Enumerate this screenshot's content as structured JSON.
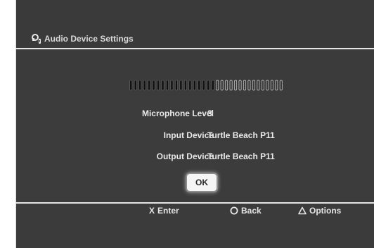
{
  "dialog": {
    "title": "Audio Device Settings",
    "title_icon": "headset-icon"
  },
  "meter": {
    "level_fraction": 0.55,
    "total_segments": 34,
    "filled_color": "#111111",
    "empty_color": "#cfcfcf"
  },
  "settings": {
    "mic_label": "Microphone Level",
    "mic_value": "3",
    "input_label": "Input Device",
    "input_value": "Turtle Beach P11",
    "output_label": "Output Device",
    "output_value": "Turtle Beach P11"
  },
  "buttons": {
    "ok_label": "OK"
  },
  "footer": {
    "enter_glyph": "X",
    "enter_label": "Enter",
    "back_label": "Back",
    "back_icon": "circle-icon",
    "options_label": "Options",
    "options_icon": "triangle-icon"
  }
}
